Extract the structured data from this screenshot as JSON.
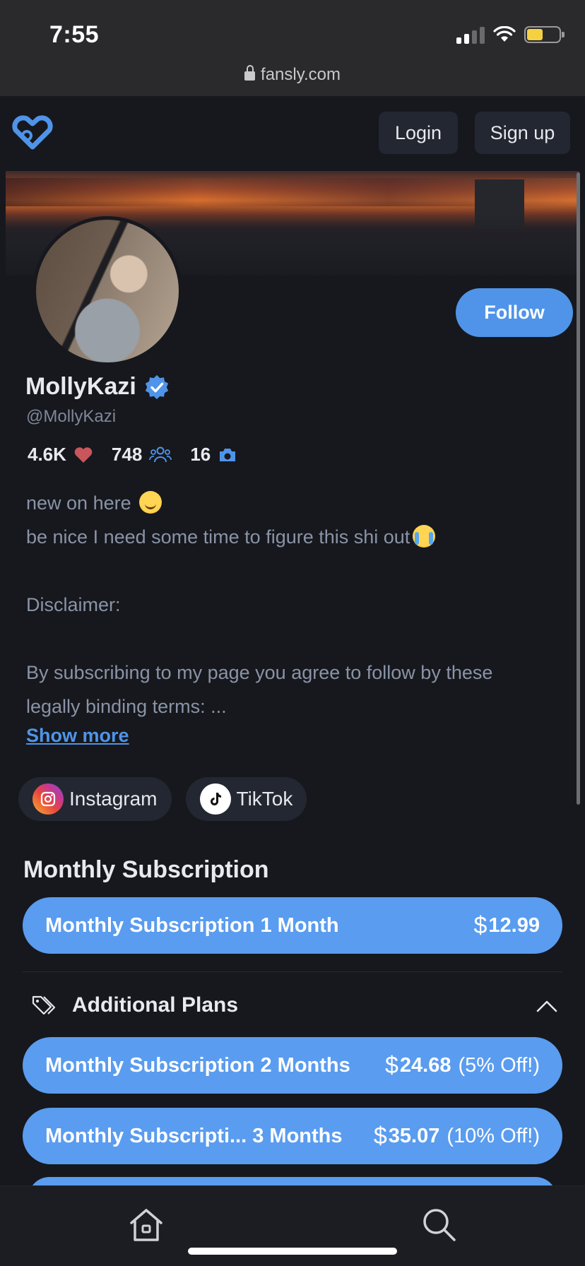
{
  "status_bar": {
    "time": "7:55",
    "url": "fansly.com"
  },
  "header": {
    "login_label": "Login",
    "signup_label": "Sign up"
  },
  "profile": {
    "follow_label": "Follow",
    "display_name": "MollyKazi",
    "handle": "@MollyKazi",
    "stats": {
      "likes": "4.6K",
      "followers": "748",
      "media": "16"
    },
    "bio_lines": [
      "new on here",
      "be nice I need some time to figure this shi out",
      "",
      "Disclaimer:",
      "",
      "By subscribing to my page you agree to follow by these",
      "legally binding terms: ..."
    ],
    "show_more_label": "Show more "
  },
  "socials": [
    {
      "label": "Instagram",
      "icon": "instagram-icon"
    },
    {
      "label": "TikTok",
      "icon": "tiktok-icon"
    }
  ],
  "subscription": {
    "section_title": "Monthly Subscription",
    "main_plan": {
      "name": "Monthly Subscription",
      "duration": "1 Month",
      "currency": "$",
      "price": "12.99"
    },
    "additional_title": "Additional Plans",
    "plans": [
      {
        "name": "Monthly Subscription",
        "duration": "2 Months",
        "currency": "$",
        "price": "24.68",
        "discount": "(5% Off!)"
      },
      {
        "name": "Monthly Subscripti...",
        "duration": "3 Months",
        "currency": "$",
        "price": "35.07",
        "discount": "(10% Off!)"
      }
    ]
  },
  "colors": {
    "accent": "#4f94e8",
    "plan_bg": "#5a9cef",
    "background": "#16181d",
    "heart": "#c9565b"
  }
}
